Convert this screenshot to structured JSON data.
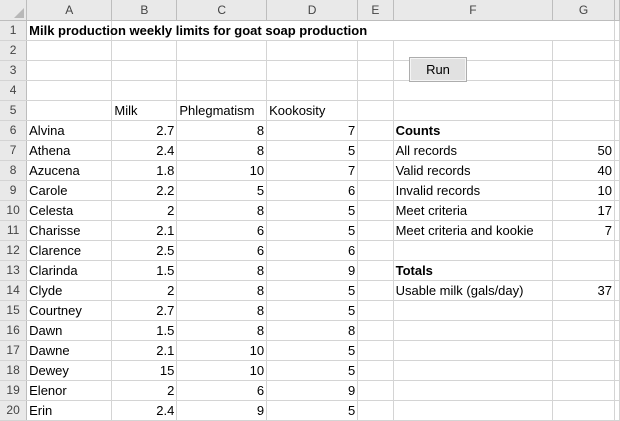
{
  "columns": [
    "A",
    "B",
    "C",
    "D",
    "E",
    "F",
    "G"
  ],
  "row_numbers": [
    "1",
    "2",
    "3",
    "4",
    "5",
    "6",
    "7",
    "8",
    "9",
    "10",
    "11",
    "12",
    "13",
    "14",
    "15",
    "16",
    "17",
    "18",
    "19",
    "20"
  ],
  "title": "Milk production weekly limits for goat soap production",
  "run_button_label": "Run",
  "table_headers": {
    "milk": "Milk",
    "phlegmatism": "Phlegmatism",
    "kookosity": "Kookosity"
  },
  "goats": [
    {
      "name": "Alvina",
      "milk": "2.7",
      "phlegmatism": "8",
      "kookosity": "7"
    },
    {
      "name": "Athena",
      "milk": "2.4",
      "phlegmatism": "8",
      "kookosity": "5"
    },
    {
      "name": "Azucena",
      "milk": "1.8",
      "phlegmatism": "10",
      "kookosity": "7"
    },
    {
      "name": "Carole",
      "milk": "2.2",
      "phlegmatism": "5",
      "kookosity": "6"
    },
    {
      "name": "Celesta",
      "milk": "2",
      "phlegmatism": "8",
      "kookosity": "5"
    },
    {
      "name": "Charisse",
      "milk": "2.1",
      "phlegmatism": "6",
      "kookosity": "5"
    },
    {
      "name": "Clarence",
      "milk": "2.5",
      "phlegmatism": "6",
      "kookosity": "6"
    },
    {
      "name": "Clarinda",
      "milk": "1.5",
      "phlegmatism": "8",
      "kookosity": "9"
    },
    {
      "name": "Clyde",
      "milk": "2",
      "phlegmatism": "8",
      "kookosity": "5"
    },
    {
      "name": "Courtney",
      "milk": "2.7",
      "phlegmatism": "8",
      "kookosity": "5"
    },
    {
      "name": "Dawn",
      "milk": "1.5",
      "phlegmatism": "8",
      "kookosity": "8"
    },
    {
      "name": "Dawne",
      "milk": "2.1",
      "phlegmatism": "10",
      "kookosity": "5"
    },
    {
      "name": "Dewey",
      "milk": "15",
      "phlegmatism": "10",
      "kookosity": "5"
    },
    {
      "name": "Elenor",
      "milk": "2",
      "phlegmatism": "6",
      "kookosity": "9"
    },
    {
      "name": "Erin",
      "milk": "2.4",
      "phlegmatism": "9",
      "kookosity": "5"
    }
  ],
  "counts": {
    "heading": "Counts",
    "rows": [
      {
        "label": "All records",
        "value": "50"
      },
      {
        "label": "Valid records",
        "value": "40"
      },
      {
        "label": "Invalid records",
        "value": "10"
      },
      {
        "label": "Meet criteria",
        "value": "17"
      },
      {
        "label": "Meet criteria and kookie",
        "value": "7"
      }
    ]
  },
  "totals": {
    "heading": "Totals",
    "rows": [
      {
        "label": "Usable milk (gals/day)",
        "value": "37"
      }
    ]
  },
  "colors": {
    "header_bg": "#e9e9e9",
    "gridline": "#d4d4d4",
    "button_bg": "#e1e1e1"
  }
}
